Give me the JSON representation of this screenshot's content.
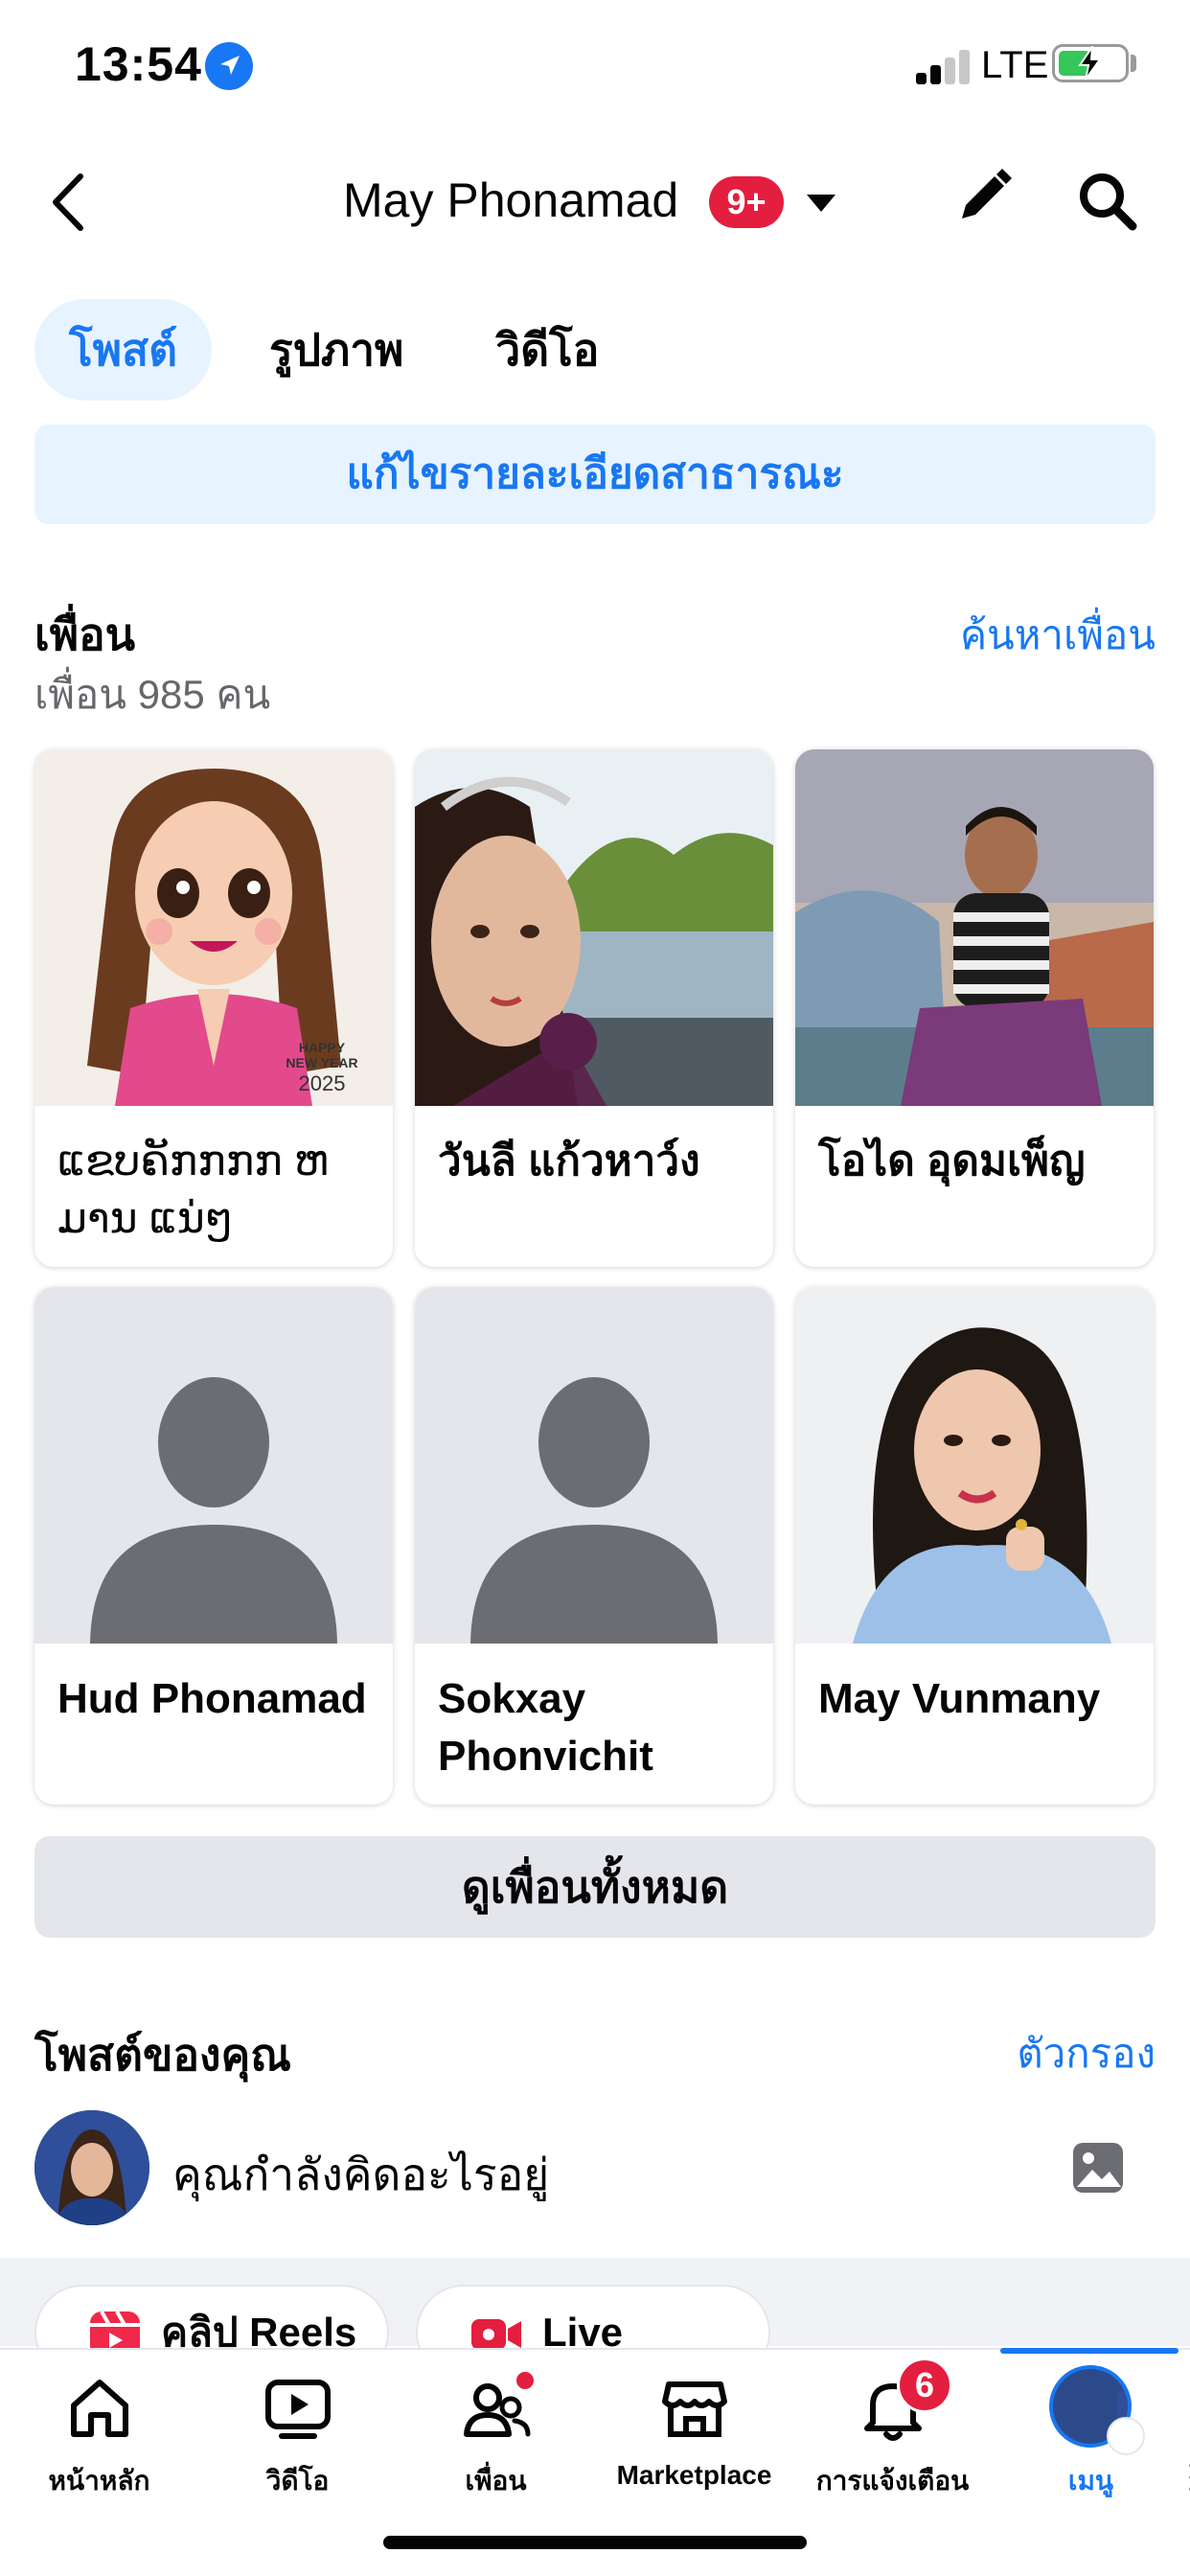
{
  "status": {
    "time": "13:54",
    "network": "LTE"
  },
  "header": {
    "title": "May Phonamad",
    "badge": "9+"
  },
  "tabs": [
    {
      "label": "โพสต์",
      "active": true
    },
    {
      "label": "รูปภาพ",
      "active": false
    },
    {
      "label": "วิดีโอ",
      "active": false
    }
  ],
  "edit_public_label": "แก้ไขรายละเอียดสาธารณะ",
  "friends": {
    "title": "เพื่อน",
    "count_text": "เพื่อน 985 คน",
    "find_link": "ค้นหาเพื่อน",
    "list": [
      {
        "name": "ແຂບຄັກກກກ ຫມານ ແນ່ໆ",
        "photo_caption": "HAPPY NEW YEAR 2025"
      },
      {
        "name": "วันลี แก้วหาว์ง"
      },
      {
        "name": "โอได อุดมเพ็ญ"
      },
      {
        "name": "Hud Phonamad"
      },
      {
        "name": "Sokxay Phonvichit"
      },
      {
        "name": "May Vunmany"
      }
    ],
    "see_all": "ดูเพื่อนทั้งหมด"
  },
  "posts": {
    "title": "โพสต์ของคุณ",
    "filter_link": "ตัวกรอง",
    "composer_placeholder": "คุณกำลังคิดอะไรอยู่"
  },
  "chips": [
    {
      "label": "คลิป Reels",
      "icon": "reels-icon"
    },
    {
      "label": "Live",
      "icon": "live-camera-icon"
    }
  ],
  "bottom_nav": [
    {
      "label": "หน้าหลัก",
      "icon": "home-icon"
    },
    {
      "label": "วิดีโอ",
      "icon": "video-icon"
    },
    {
      "label": "เพื่อน",
      "icon": "friends-icon",
      "dot": true
    },
    {
      "label": "Marketplace",
      "icon": "marketplace-icon"
    },
    {
      "label": "การแจ้งเตือน",
      "icon": "bell-icon",
      "badge": "6"
    },
    {
      "label": "เมนู",
      "icon": "menu-avatar",
      "active": true
    }
  ],
  "colors": {
    "accent": "#1877f2",
    "badge": "#e41e3f",
    "light_accent": "#e7f3ff",
    "gray_button": "#e4e6eb"
  }
}
